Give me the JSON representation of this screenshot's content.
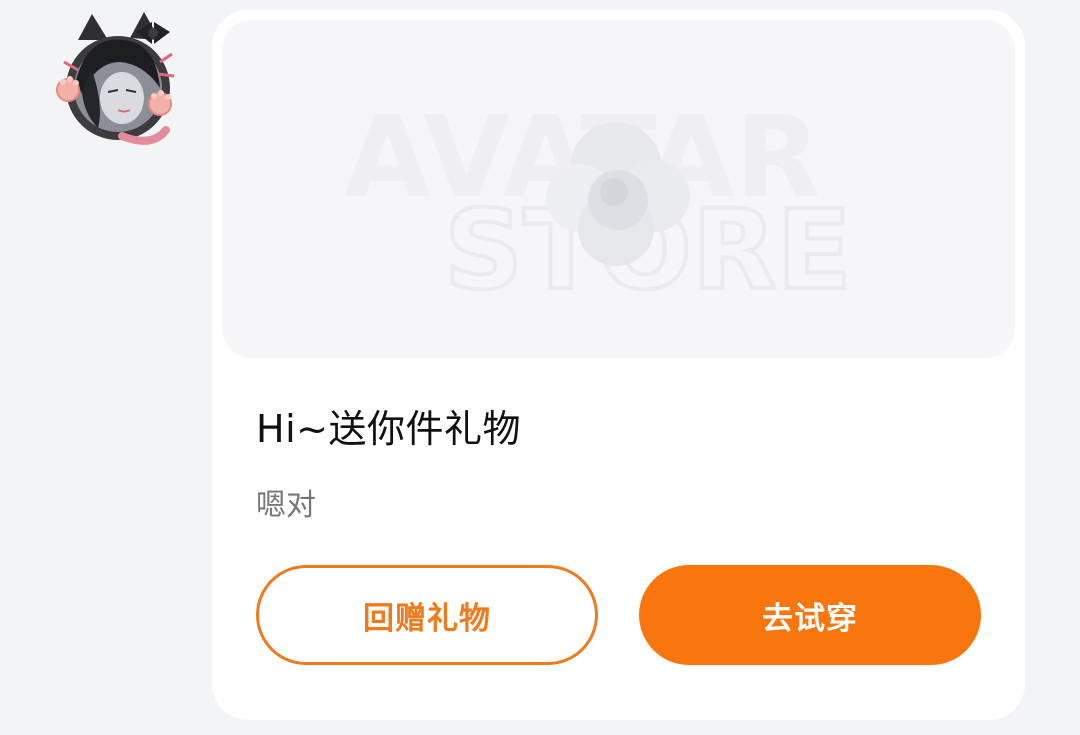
{
  "sender": {
    "avatar_icon": "cat-ear-anime-avatar-icon"
  },
  "gift_card": {
    "banner": {
      "watermark_line1": "AVATAR",
      "watermark_line2": "STORE",
      "icon": "cloud-gift-icon"
    },
    "title": "Hi~送你件礼物",
    "message": "嗯对",
    "buttons": {
      "return_gift": "回赠礼物",
      "try_on": "去试穿"
    }
  },
  "colors": {
    "accent": "#f9760f",
    "outline": "#f07a1c",
    "page_bg": "#f3f4f6",
    "card_bg": "#ffffff"
  }
}
